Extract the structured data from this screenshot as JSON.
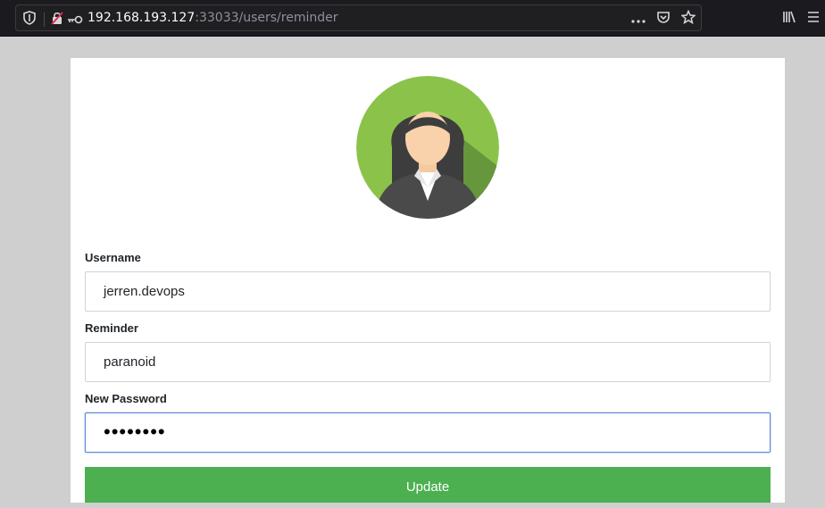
{
  "browser": {
    "url_host": "192.168.193.127",
    "url_rest": ":33033/users/reminder",
    "icons": [
      "shield-icon",
      "insecure-lock-icon",
      "key-icon",
      "more-icon",
      "pocket-icon",
      "bookmark-star-icon",
      "library-icon",
      "menu-icon"
    ]
  },
  "form": {
    "username_label": "Username",
    "username_value": "jerren.devops",
    "reminder_label": "Reminder",
    "reminder_value": "paranoid",
    "password_label": "New Password",
    "password_masked": "••••••••",
    "submit_label": "Update"
  },
  "colors": {
    "button": "#4caf50",
    "avatar_bg": "#8bc34a",
    "focus_border": "#5b8bd6"
  }
}
